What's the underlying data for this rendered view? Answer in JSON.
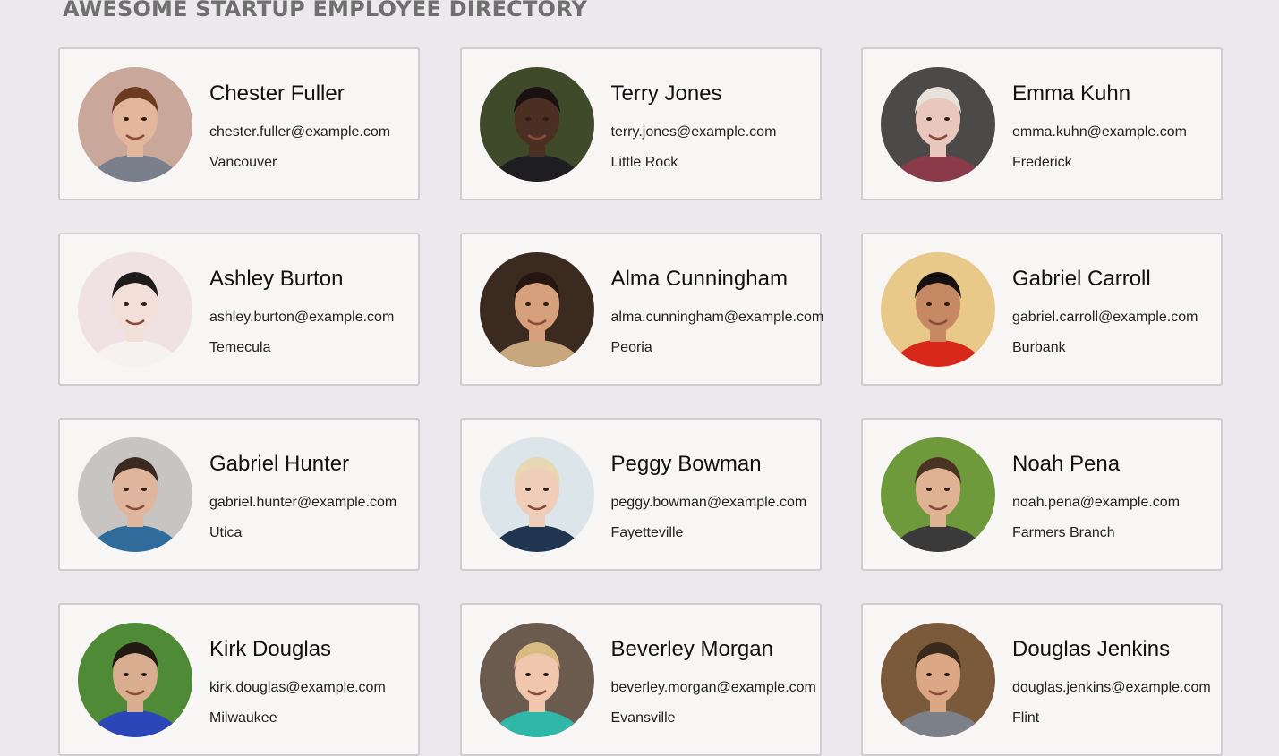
{
  "page": {
    "title": "AWESOME STARTUP EMPLOYEE DIRECTORY"
  },
  "employees": [
    {
      "name": "Chester Fuller",
      "email": "chester.fuller@example.com",
      "city": "Vancouver",
      "photo": {
        "bg": "#c9a79a",
        "skin": "#e3b79c",
        "hair": "#6b3b22",
        "shirt": "#7a7f8c"
      }
    },
    {
      "name": "Terry Jones",
      "email": "terry.jones@example.com",
      "city": "Little Rock",
      "photo": {
        "bg": "#3e4a2a",
        "skin": "#4a2f22",
        "hair": "#1a1210",
        "shirt": "#1e1e22"
      }
    },
    {
      "name": "Emma Kuhn",
      "email": "emma.kuhn@example.com",
      "city": "Frederick",
      "photo": {
        "bg": "#4b4a48",
        "skin": "#eac7bd",
        "hair": "#e6e2dc",
        "shirt": "#8b3a4a"
      }
    },
    {
      "name": "Ashley Burton",
      "email": "ashley.burton@example.com",
      "city": "Temecula",
      "photo": {
        "bg": "#f0e1e3",
        "skin": "#f1dfd8",
        "hair": "#1f1a1c",
        "shirt": "#f6f2f2"
      }
    },
    {
      "name": "Alma Cunningham",
      "email": "alma.cunningham@example.com",
      "city": "Peoria",
      "photo": {
        "bg": "#3b2a1f",
        "skin": "#d7a07d",
        "hair": "#25160f",
        "shirt": "#c7a77b"
      }
    },
    {
      "name": "Gabriel Carroll",
      "email": "gabriel.carroll@example.com",
      "city": "Burbank",
      "photo": {
        "bg": "#e9c98a",
        "skin": "#c78964",
        "hair": "#171010",
        "shirt": "#d8281c"
      }
    },
    {
      "name": "Gabriel Hunter",
      "email": "gabriel.hunter@example.com",
      "city": "Utica",
      "photo": {
        "bg": "#c7c4c2",
        "skin": "#e0b59d",
        "hair": "#3b2a22",
        "shirt": "#2f6b9b"
      }
    },
    {
      "name": "Peggy Bowman",
      "email": "peggy.bowman@example.com",
      "city": "Fayetteville",
      "photo": {
        "bg": "#dbe5ea",
        "skin": "#f0cdb8",
        "hair": "#e7d8b4",
        "shirt": "#1f3550"
      }
    },
    {
      "name": "Noah Pena",
      "email": "noah.pena@example.com",
      "city": "Farmers Branch",
      "photo": {
        "bg": "#6f9a3c",
        "skin": "#dfb293",
        "hair": "#4b3324",
        "shirt": "#3a3a3a"
      }
    },
    {
      "name": "Kirk Douglas",
      "email": "kirk.douglas@example.com",
      "city": "Milwaukee",
      "photo": {
        "bg": "#4f8a37",
        "skin": "#d9ad90",
        "hair": "#231913",
        "shirt": "#2b46b8"
      }
    },
    {
      "name": "Beverley Morgan",
      "email": "beverley.morgan@example.com",
      "city": "Evansville",
      "photo": {
        "bg": "#6b5a4e",
        "skin": "#f0c6ad",
        "hair": "#d9bb82",
        "shirt": "#2fb8a8"
      }
    },
    {
      "name": "Douglas Jenkins",
      "email": "douglas.jenkins@example.com",
      "city": "Flint",
      "photo": {
        "bg": "#7a5a3a",
        "skin": "#dba784",
        "hair": "#3a2a1e",
        "shirt": "#7c8088"
      }
    }
  ]
}
